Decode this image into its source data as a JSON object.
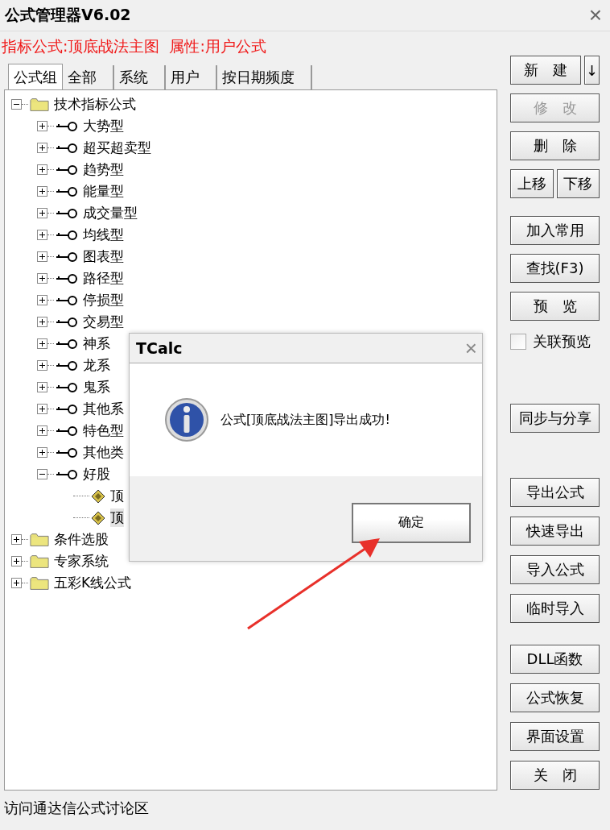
{
  "window": {
    "title": "公式管理器V6.02",
    "close": "×"
  },
  "info": {
    "formula": "指标公式:顶底战法主图",
    "property": "属性:用户公式"
  },
  "tabs": [
    {
      "label": "公式组",
      "selected": true
    },
    {
      "label": "全部",
      "selected": false
    },
    {
      "label": "系统",
      "selected": false
    },
    {
      "label": "用户",
      "selected": false
    },
    {
      "label": "按日期频度",
      "selected": false
    }
  ],
  "tree": [
    {
      "label": "技术指标公式",
      "kind": "folder",
      "expanded": true,
      "selected": false,
      "children": [
        {
          "label": "大势型",
          "kind": "group",
          "expanded": false,
          "selected": false
        },
        {
          "label": "超买超卖型",
          "kind": "group",
          "expanded": false,
          "selected": false
        },
        {
          "label": "趋势型",
          "kind": "group",
          "expanded": false,
          "selected": false
        },
        {
          "label": "能量型",
          "kind": "group",
          "expanded": false,
          "selected": false
        },
        {
          "label": "成交量型",
          "kind": "group",
          "expanded": false,
          "selected": false
        },
        {
          "label": "均线型",
          "kind": "group",
          "expanded": false,
          "selected": false
        },
        {
          "label": "图表型",
          "kind": "group",
          "expanded": false,
          "selected": false
        },
        {
          "label": "路径型",
          "kind": "group",
          "expanded": false,
          "selected": false
        },
        {
          "label": "停损型",
          "kind": "group",
          "expanded": false,
          "selected": false
        },
        {
          "label": "交易型",
          "kind": "group",
          "expanded": false,
          "selected": false
        },
        {
          "label": "神系",
          "kind": "group",
          "expanded": false,
          "selected": false
        },
        {
          "label": "龙系",
          "kind": "group",
          "expanded": false,
          "selected": false
        },
        {
          "label": "鬼系",
          "kind": "group",
          "expanded": false,
          "selected": false
        },
        {
          "label": "其他系",
          "kind": "group",
          "expanded": false,
          "selected": false
        },
        {
          "label": "特色型",
          "kind": "group",
          "expanded": false,
          "selected": false
        },
        {
          "label": "其他类",
          "kind": "group",
          "expanded": false,
          "selected": false
        },
        {
          "label": "好股",
          "kind": "group",
          "expanded": true,
          "selected": false,
          "children": [
            {
              "label": "顶",
              "kind": "formula",
              "selected": false
            },
            {
              "label": "顶",
              "kind": "formula",
              "selected": true
            }
          ]
        }
      ]
    },
    {
      "label": "条件选股",
      "kind": "folder",
      "expanded": false,
      "selected": false
    },
    {
      "label": "专家系统",
      "kind": "folder",
      "expanded": false,
      "selected": false
    },
    {
      "label": "五彩K线公式",
      "kind": "folder",
      "expanded": false,
      "selected": false
    }
  ],
  "status_link": "访问通达信公式讨论区",
  "side_groups": [
    [
      {
        "kind": "split",
        "label": "新　建",
        "extra": "↓",
        "disabled": false
      },
      {
        "kind": "button",
        "label": "修　改",
        "disabled": true
      },
      {
        "kind": "button",
        "label": "删　除",
        "disabled": false
      },
      {
        "kind": "pair",
        "label": "上移",
        "extra": "下移",
        "disabled": false
      }
    ],
    [
      {
        "kind": "button",
        "label": "加入常用",
        "disabled": false
      },
      {
        "kind": "button",
        "label": "查找(F3)",
        "disabled": false
      },
      {
        "kind": "button",
        "label": "预　览",
        "disabled": false
      },
      {
        "kind": "checkbox",
        "label": "关联预览",
        "checked": false
      }
    ],
    [
      {
        "kind": "button",
        "label": "同步与分享",
        "disabled": false
      }
    ],
    [
      {
        "kind": "button",
        "label": "导出公式",
        "disabled": false
      },
      {
        "kind": "button",
        "label": "快速导出",
        "disabled": false
      },
      {
        "kind": "button",
        "label": "导入公式",
        "disabled": false
      },
      {
        "kind": "button",
        "label": "临时导入",
        "disabled": false
      }
    ],
    [
      {
        "kind": "button",
        "label": "DLL函数",
        "disabled": false
      },
      {
        "kind": "button",
        "label": "公式恢复",
        "disabled": false
      },
      {
        "kind": "button",
        "label": "界面设置",
        "disabled": false
      },
      {
        "kind": "button",
        "label": "关　闭",
        "disabled": false
      }
    ]
  ],
  "dialog": {
    "title": "TCalc",
    "close": "×",
    "message": "公式[顶底战法主图]导出成功!",
    "ok": "确定"
  }
}
